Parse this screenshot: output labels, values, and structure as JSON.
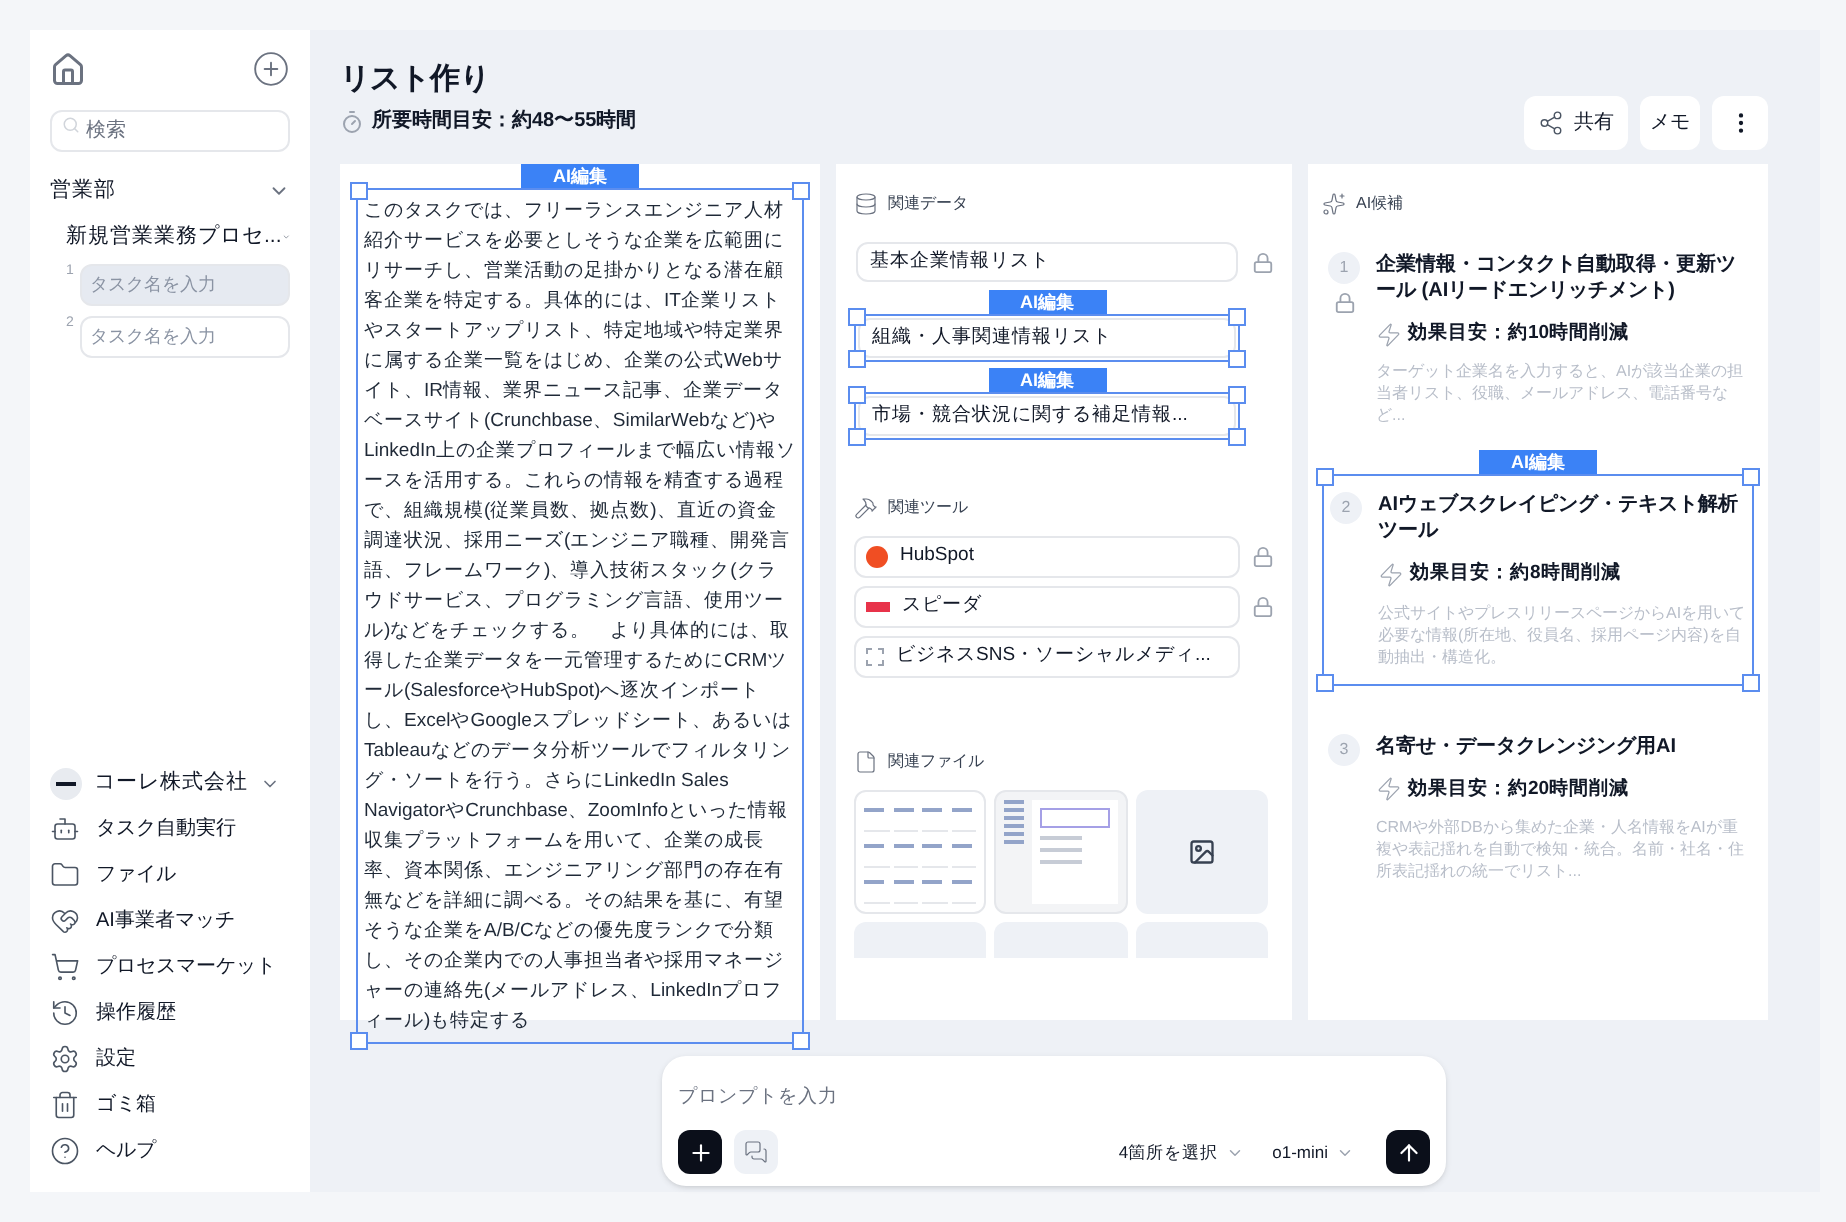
{
  "sidebar": {
    "search": {
      "placeholder": "検索"
    },
    "tree": [
      {
        "label": "営業部",
        "expanded": true,
        "children": [
          {
            "label": "新規営業業務プロセ...",
            "expanded": true,
            "tasks": [
              {
                "number": "1",
                "placeholder": "タスク名を入力",
                "selected": true
              },
              {
                "number": "2",
                "placeholder": "タスク名を入力",
                "selected": false
              }
            ]
          }
        ]
      }
    ],
    "company": {
      "name": "コーレ株式会社"
    },
    "nav": [
      {
        "kind": "robot",
        "label": "タスク自動実行"
      },
      {
        "kind": "folder",
        "label": "ファイル"
      },
      {
        "kind": "handshake",
        "label": "AI事業者マッチ"
      },
      {
        "kind": "cart",
        "label": "プロセスマーケット"
      },
      {
        "kind": "history",
        "label": "操作履歴"
      },
      {
        "kind": "gear",
        "label": "設定"
      },
      {
        "kind": "trash",
        "label": "ゴミ箱"
      },
      {
        "kind": "help",
        "label": "ヘルプ"
      }
    ]
  },
  "header": {
    "title": "リスト作り",
    "estimate": "所要時間目安：約48〜55時間",
    "buttons": [
      {
        "kind": "share",
        "label": "共有"
      },
      {
        "kind": "text",
        "label": "メモ"
      },
      {
        "kind": "more"
      }
    ]
  },
  "description": {
    "ai_edit_label": "AI編集",
    "text": "このタスクでは、フリーランスエンジニア人材紹介サービスを必要としそうな企業を広範囲にリサーチし、営業活動の足掛かりとなる潜在顧客企業を特定する。具体的には、IT企業リストやスタートアップリスト、特定地域や特定業界に属する企業一覧をはじめ、企業の公式Webサイト、IR情報、業界ニュース記事、企業データベースサイト(Crunchbase、SimilarWebなど)やLinkedIn上の企業プロフィールまで幅広い情報ソースを活用する。これらの情報を精査する過程で、組織規模(従業員数、拠点数)、直近の資金調達状況、採用ニーズ(エンジニア職種、開発言語、フレームワーク)、導入技術スタック(クラウドサービス、プログラミング言語、使用ツール)などをチェックする。　より具体的には、取得した企業データを一元管理するためにCRMツール(SalesforceやHubSpot)へ逐次インポートし、ExcelやGoogleスプレッドシート、あるいはTableauなどのデータ分析ツールでフィルタリング・ソートを行う。さらにLinkedIn Sales NavigatorやCrunchbase、ZoomInfoといった情報収集プラットフォームを用いて、企業の成長率、資本関係、エンジニアリング部門の存在有無などを詳細に調べる。その結果を基に、有望そうな企業をA/B/Cなどの優先度ランクで分類し、その企業内での人事担当者や採用マネージャーの連絡先(メールアドレス、LinkedInプロフィール)も特定する"
  },
  "related_data": {
    "title": "関連データ",
    "items": [
      {
        "label": "基本企業情報リスト",
        "locked": true
      },
      {
        "label": "組織・人事関連情報リスト",
        "locked": false,
        "ai_edit_label": "AI編集"
      },
      {
        "label": "市場・競合状況に関する補足情報...",
        "locked": false,
        "ai_edit_label": "AI編集"
      }
    ]
  },
  "related_tools": {
    "title": "関連ツール",
    "items": [
      {
        "kind": "circle",
        "label": "HubSpot",
        "locked": true
      },
      {
        "kind": "tag",
        "label": "スピーダ",
        "locked": true
      },
      {
        "kind": "empty",
        "label": "ビジネスSNS・ソーシャルメディ...",
        "locked": false
      }
    ]
  },
  "related_files": {
    "title": "関連ファイル",
    "items": [
      {
        "kind": "table"
      },
      {
        "kind": "screen"
      },
      {
        "kind": "image"
      },
      {
        "kind": "blank"
      },
      {
        "kind": "blank"
      },
      {
        "kind": "blank"
      }
    ]
  },
  "ai_candidates": {
    "title": "AI候補",
    "items": [
      {
        "number": "1",
        "locked": true,
        "title": "企業情報・コンタクト自動取得・更新ツール (AIリードエンリッチメント)",
        "effect": "効果目安：約10時間削減",
        "description": "ターゲット企業名を入力すると、AIが該当企業の担当者リスト、役職、メールアドレス、電話番号など..."
      },
      {
        "number": "2",
        "locked": false,
        "ai_edit_label": "AI編集",
        "title": "AIウェブスクレイピング・テキスト解析ツール",
        "effect": "効果目安：約8時間削減",
        "description": "公式サイトやプレスリリースページからAIを用いて必要な情報(所在地、役員名、採用ページ内容)を自動抽出・構造化。"
      },
      {
        "number": "3",
        "locked": false,
        "title": "名寄せ・データクレンジング用AI",
        "effect": "効果目安：約20時間削減",
        "description": "CRMや外部DBから集めた企業・人名情報をAIが重複や表記揺れを自動で検知・統合。名前・社名・住所表記揺れの統一でリスト..."
      }
    ]
  },
  "prompt": {
    "placeholder": "プロンプトを入力",
    "selection": "4箇所を選択",
    "model": "o1-mini"
  }
}
